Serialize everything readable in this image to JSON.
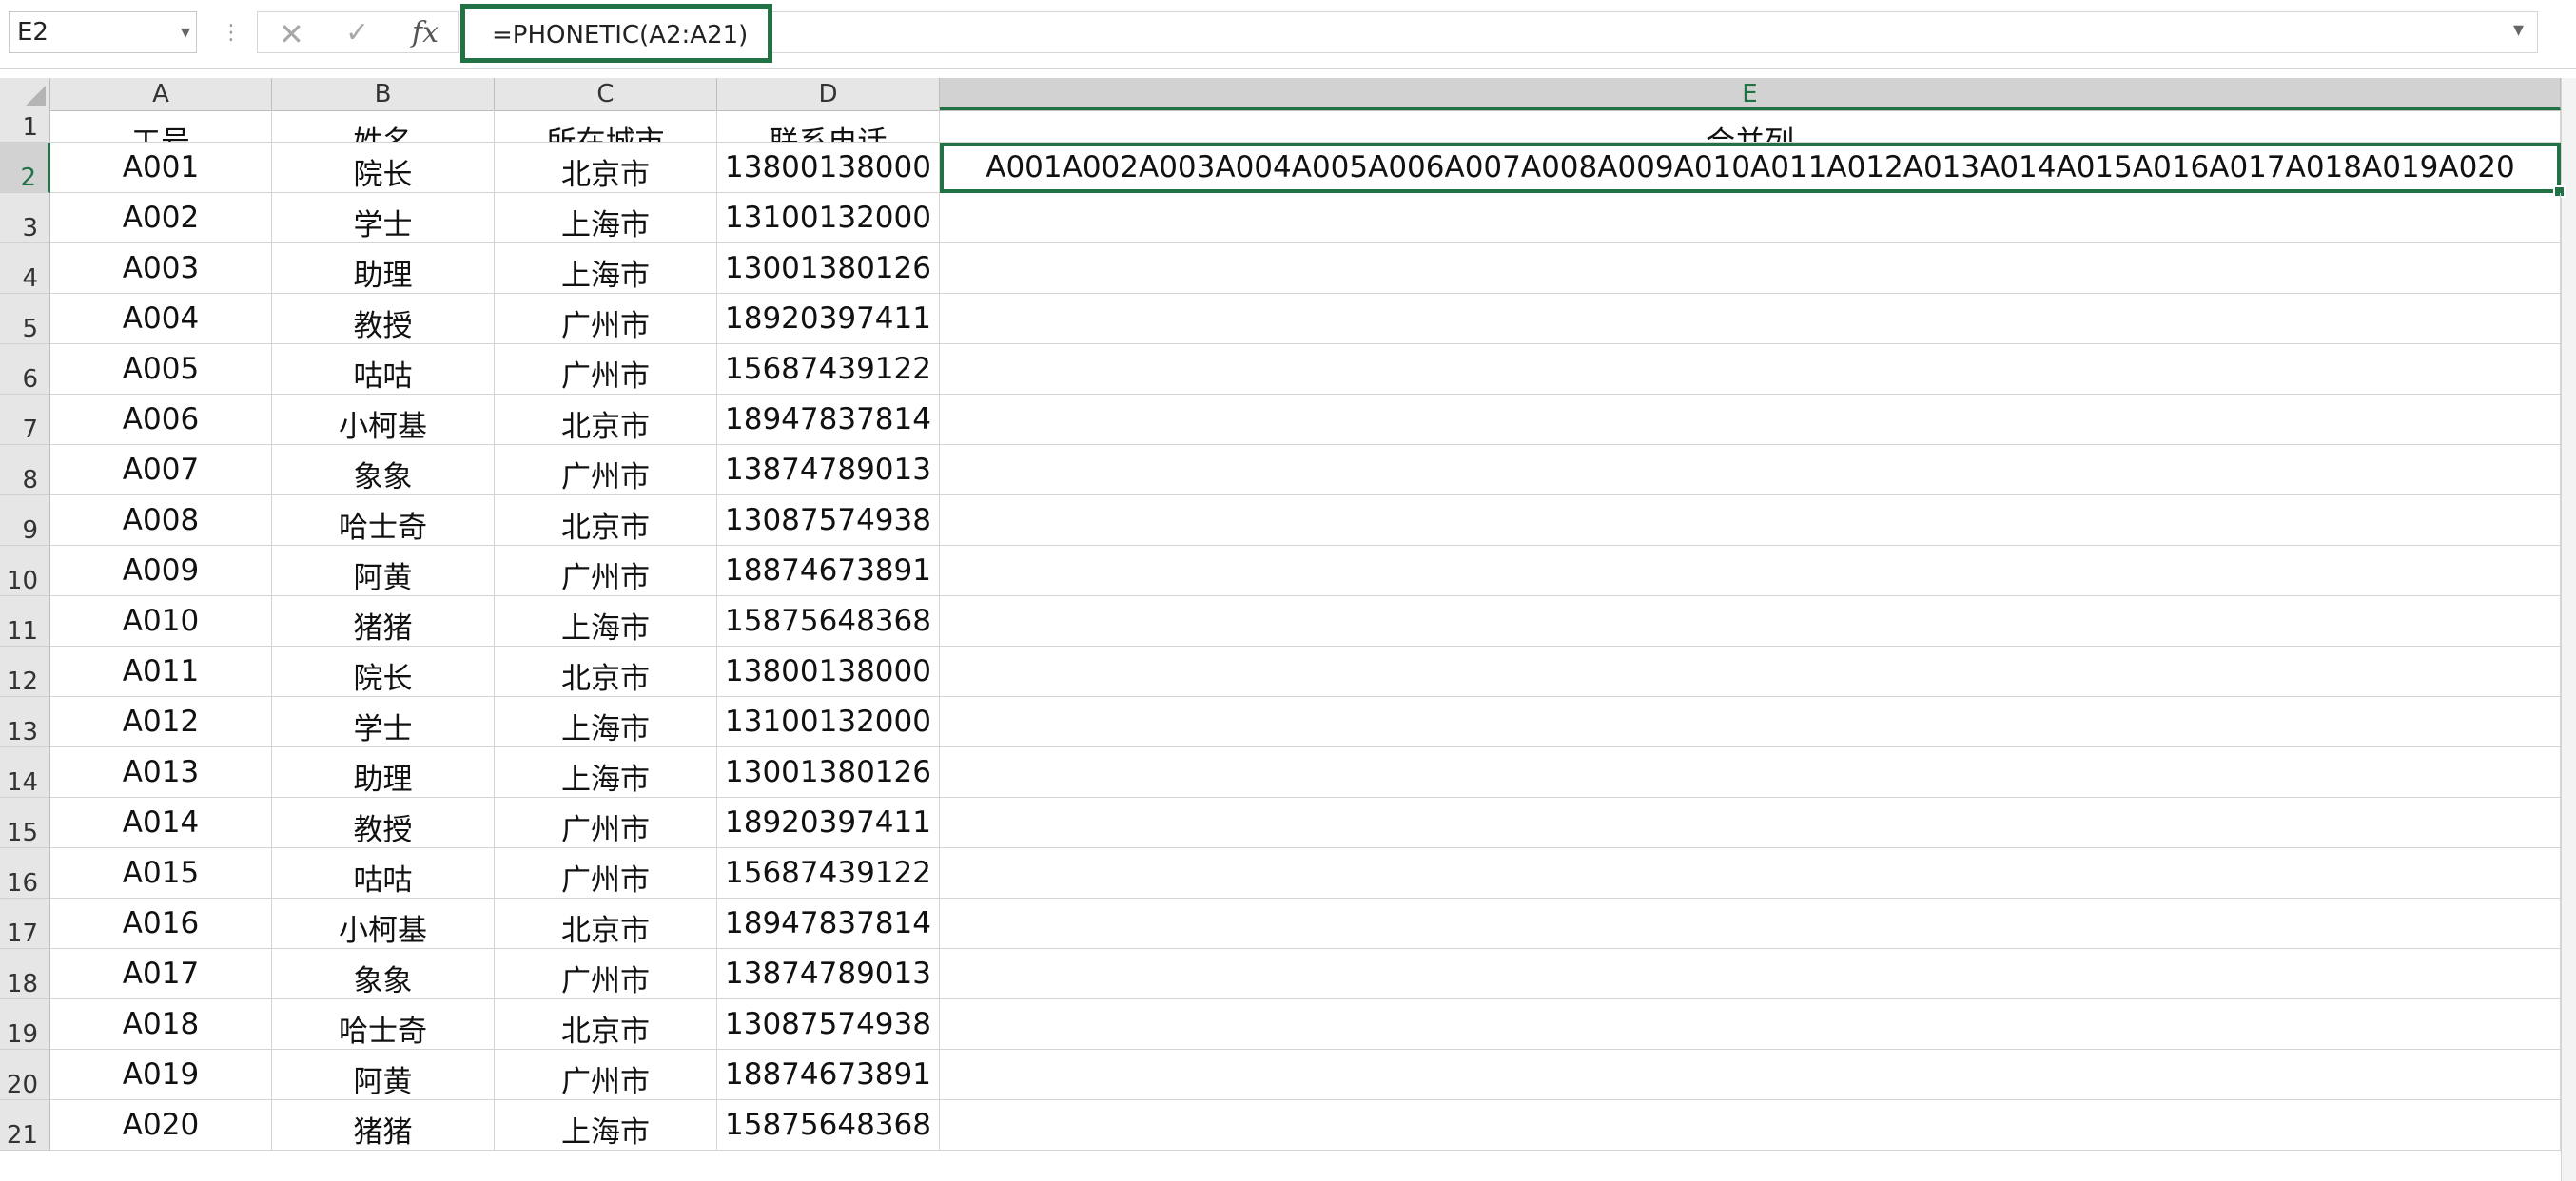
{
  "formula_bar": {
    "name_box": "E2",
    "formula": "=PHONETIC(A2:A21)",
    "fx_label": "fx",
    "cancel_icon": "✕",
    "enter_icon": "✓",
    "separator": "⋮",
    "dropdown_icon": "▾",
    "expand_icon": "▾"
  },
  "sheet": {
    "columns": [
      "A",
      "B",
      "C",
      "D",
      "E"
    ],
    "selected_cell": "E2",
    "rows": [
      [
        "工号",
        "姓名",
        "所在城市",
        "联系电话",
        "合并列"
      ],
      [
        "A001",
        "院长",
        "北京市",
        "13800138000",
        "A001A002A003A004A005A006A007A008A009A010A011A012A013A014A015A016A017A018A019A020"
      ],
      [
        "A002",
        "学士",
        "上海市",
        "13100132000",
        ""
      ],
      [
        "A003",
        "助理",
        "上海市",
        "13001380126",
        ""
      ],
      [
        "A004",
        "教授",
        "广州市",
        "18920397411",
        ""
      ],
      [
        "A005",
        "咕咕",
        "广州市",
        "15687439122",
        ""
      ],
      [
        "A006",
        "小柯基",
        "北京市",
        "18947837814",
        ""
      ],
      [
        "A007",
        "象象",
        "广州市",
        "13874789013",
        ""
      ],
      [
        "A008",
        "哈士奇",
        "北京市",
        "13087574938",
        ""
      ],
      [
        "A009",
        "阿黄",
        "广州市",
        "18874673891",
        ""
      ],
      [
        "A010",
        "猪猪",
        "上海市",
        "15875648368",
        ""
      ],
      [
        "A011",
        "院长",
        "北京市",
        "13800138000",
        ""
      ],
      [
        "A012",
        "学士",
        "上海市",
        "13100132000",
        ""
      ],
      [
        "A013",
        "助理",
        "上海市",
        "13001380126",
        ""
      ],
      [
        "A014",
        "教授",
        "广州市",
        "18920397411",
        ""
      ],
      [
        "A015",
        "咕咕",
        "广州市",
        "15687439122",
        ""
      ],
      [
        "A016",
        "小柯基",
        "北京市",
        "18947837814",
        ""
      ],
      [
        "A017",
        "象象",
        "广州市",
        "13874789013",
        ""
      ],
      [
        "A018",
        "哈士奇",
        "北京市",
        "13087574938",
        ""
      ],
      [
        "A019",
        "阿黄",
        "广州市",
        "18874673891",
        ""
      ],
      [
        "A020",
        "猪猪",
        "上海市",
        "15875648368",
        ""
      ]
    ]
  }
}
